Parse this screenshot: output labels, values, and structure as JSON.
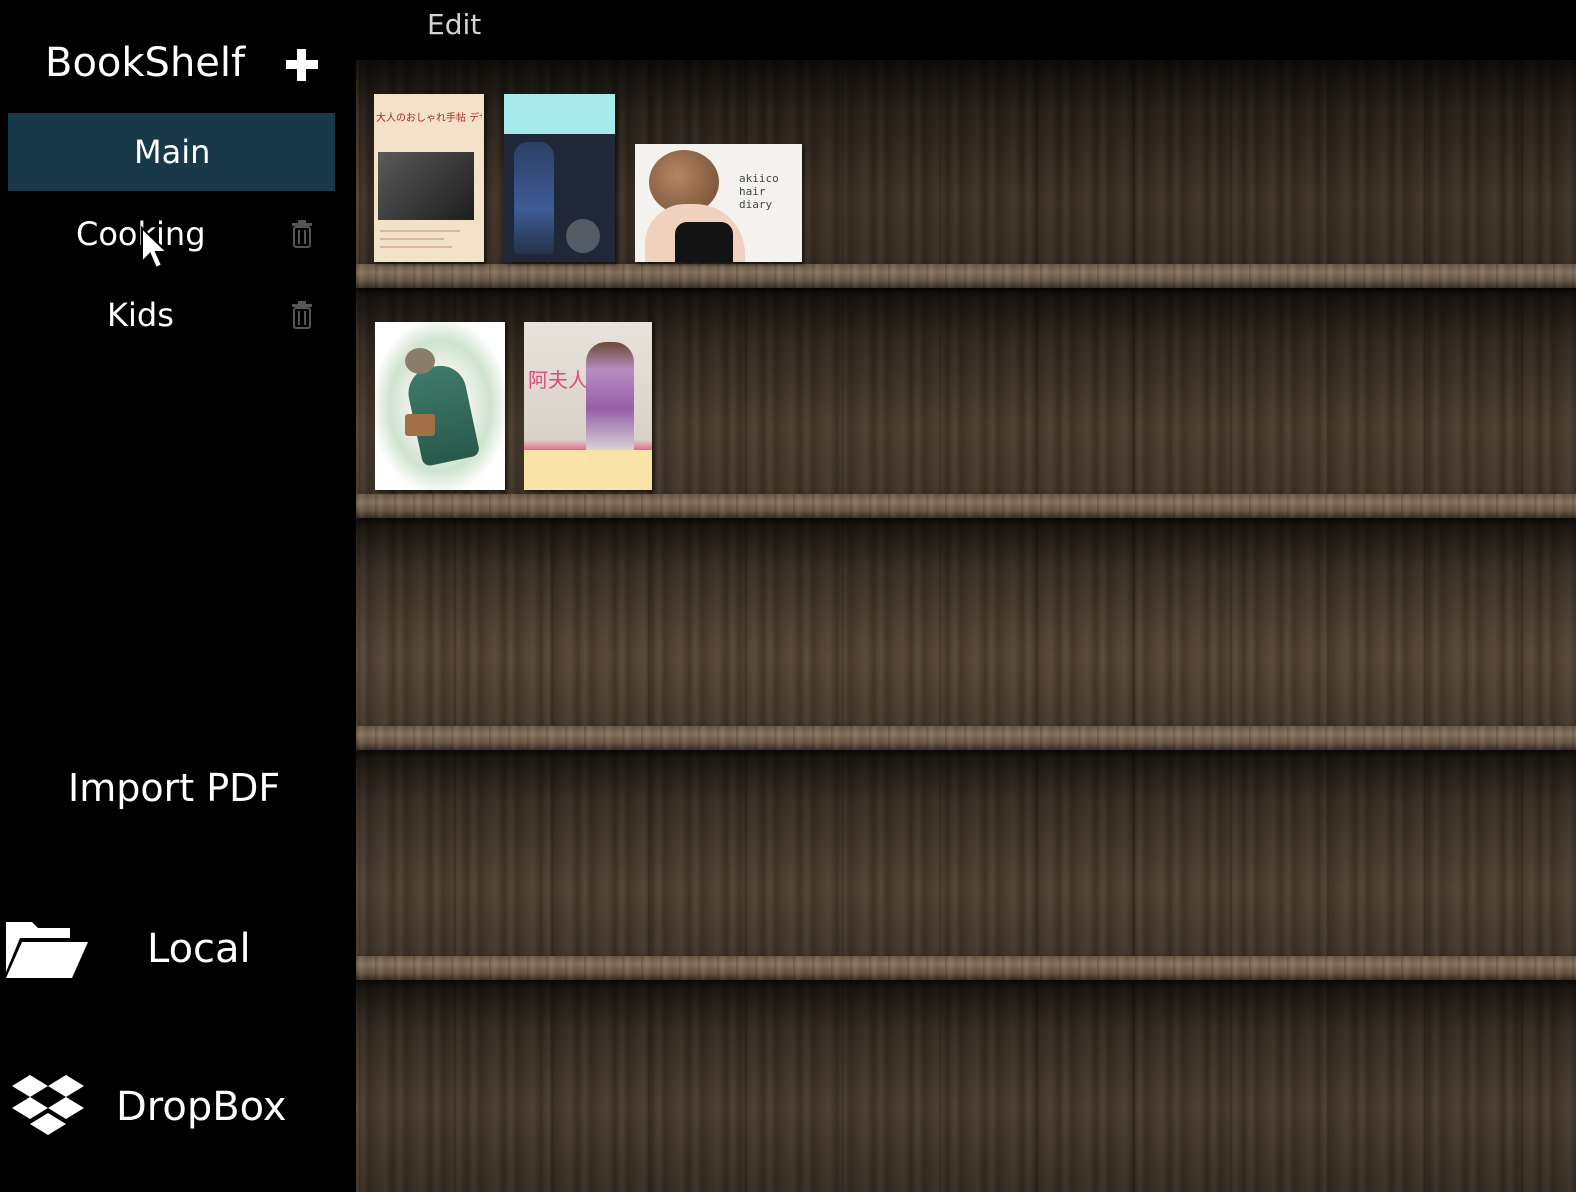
{
  "menu": {
    "edit_label": "Edit"
  },
  "sidebar": {
    "title": "BookShelf",
    "shelves": [
      {
        "label": "Main",
        "active": true
      },
      {
        "label": "Cooking",
        "active": false
      },
      {
        "label": "Kids",
        "active": false
      }
    ],
    "import_label": "Import PDF",
    "sources": [
      {
        "label": "Local",
        "icon": "folder-open-icon"
      },
      {
        "label": "DropBox",
        "icon": "dropbox-icon"
      }
    ]
  },
  "bookshelf": {
    "rows": [
      {
        "books": [
          "book-1",
          "book-2",
          "book-3"
        ]
      },
      {
        "books": [
          "book-4",
          "book-5"
        ]
      },
      {
        "books": []
      },
      {
        "books": []
      },
      {
        "books": []
      }
    ]
  },
  "colors": {
    "background": "#000000",
    "active_shelf": "#18394a",
    "text": "#ffffff",
    "menu_text": "#d4d4d4"
  }
}
